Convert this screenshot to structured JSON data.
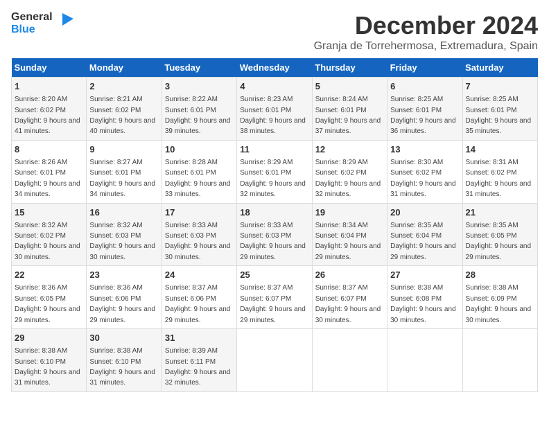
{
  "logo": {
    "general": "General",
    "blue": "Blue"
  },
  "title": "December 2024",
  "subtitle": "Granja de Torrehermosa, Extremadura, Spain",
  "days": [
    "Sunday",
    "Monday",
    "Tuesday",
    "Wednesday",
    "Thursday",
    "Friday",
    "Saturday"
  ],
  "weeks": [
    [
      {
        "day": "1",
        "sunrise": "Sunrise: 8:20 AM",
        "sunset": "Sunset: 6:02 PM",
        "daylight": "Daylight: 9 hours and 41 minutes."
      },
      {
        "day": "2",
        "sunrise": "Sunrise: 8:21 AM",
        "sunset": "Sunset: 6:02 PM",
        "daylight": "Daylight: 9 hours and 40 minutes."
      },
      {
        "day": "3",
        "sunrise": "Sunrise: 8:22 AM",
        "sunset": "Sunset: 6:01 PM",
        "daylight": "Daylight: 9 hours and 39 minutes."
      },
      {
        "day": "4",
        "sunrise": "Sunrise: 8:23 AM",
        "sunset": "Sunset: 6:01 PM",
        "daylight": "Daylight: 9 hours and 38 minutes."
      },
      {
        "day": "5",
        "sunrise": "Sunrise: 8:24 AM",
        "sunset": "Sunset: 6:01 PM",
        "daylight": "Daylight: 9 hours and 37 minutes."
      },
      {
        "day": "6",
        "sunrise": "Sunrise: 8:25 AM",
        "sunset": "Sunset: 6:01 PM",
        "daylight": "Daylight: 9 hours and 36 minutes."
      },
      {
        "day": "7",
        "sunrise": "Sunrise: 8:25 AM",
        "sunset": "Sunset: 6:01 PM",
        "daylight": "Daylight: 9 hours and 35 minutes."
      }
    ],
    [
      {
        "day": "8",
        "sunrise": "Sunrise: 8:26 AM",
        "sunset": "Sunset: 6:01 PM",
        "daylight": "Daylight: 9 hours and 34 minutes."
      },
      {
        "day": "9",
        "sunrise": "Sunrise: 8:27 AM",
        "sunset": "Sunset: 6:01 PM",
        "daylight": "Daylight: 9 hours and 34 minutes."
      },
      {
        "day": "10",
        "sunrise": "Sunrise: 8:28 AM",
        "sunset": "Sunset: 6:01 PM",
        "daylight": "Daylight: 9 hours and 33 minutes."
      },
      {
        "day": "11",
        "sunrise": "Sunrise: 8:29 AM",
        "sunset": "Sunset: 6:01 PM",
        "daylight": "Daylight: 9 hours and 32 minutes."
      },
      {
        "day": "12",
        "sunrise": "Sunrise: 8:29 AM",
        "sunset": "Sunset: 6:02 PM",
        "daylight": "Daylight: 9 hours and 32 minutes."
      },
      {
        "day": "13",
        "sunrise": "Sunrise: 8:30 AM",
        "sunset": "Sunset: 6:02 PM",
        "daylight": "Daylight: 9 hours and 31 minutes."
      },
      {
        "day": "14",
        "sunrise": "Sunrise: 8:31 AM",
        "sunset": "Sunset: 6:02 PM",
        "daylight": "Daylight: 9 hours and 31 minutes."
      }
    ],
    [
      {
        "day": "15",
        "sunrise": "Sunrise: 8:32 AM",
        "sunset": "Sunset: 6:02 PM",
        "daylight": "Daylight: 9 hours and 30 minutes."
      },
      {
        "day": "16",
        "sunrise": "Sunrise: 8:32 AM",
        "sunset": "Sunset: 6:03 PM",
        "daylight": "Daylight: 9 hours and 30 minutes."
      },
      {
        "day": "17",
        "sunrise": "Sunrise: 8:33 AM",
        "sunset": "Sunset: 6:03 PM",
        "daylight": "Daylight: 9 hours and 30 minutes."
      },
      {
        "day": "18",
        "sunrise": "Sunrise: 8:33 AM",
        "sunset": "Sunset: 6:03 PM",
        "daylight": "Daylight: 9 hours and 29 minutes."
      },
      {
        "day": "19",
        "sunrise": "Sunrise: 8:34 AM",
        "sunset": "Sunset: 6:04 PM",
        "daylight": "Daylight: 9 hours and 29 minutes."
      },
      {
        "day": "20",
        "sunrise": "Sunrise: 8:35 AM",
        "sunset": "Sunset: 6:04 PM",
        "daylight": "Daylight: 9 hours and 29 minutes."
      },
      {
        "day": "21",
        "sunrise": "Sunrise: 8:35 AM",
        "sunset": "Sunset: 6:05 PM",
        "daylight": "Daylight: 9 hours and 29 minutes."
      }
    ],
    [
      {
        "day": "22",
        "sunrise": "Sunrise: 8:36 AM",
        "sunset": "Sunset: 6:05 PM",
        "daylight": "Daylight: 9 hours and 29 minutes."
      },
      {
        "day": "23",
        "sunrise": "Sunrise: 8:36 AM",
        "sunset": "Sunset: 6:06 PM",
        "daylight": "Daylight: 9 hours and 29 minutes."
      },
      {
        "day": "24",
        "sunrise": "Sunrise: 8:37 AM",
        "sunset": "Sunset: 6:06 PM",
        "daylight": "Daylight: 9 hours and 29 minutes."
      },
      {
        "day": "25",
        "sunrise": "Sunrise: 8:37 AM",
        "sunset": "Sunset: 6:07 PM",
        "daylight": "Daylight: 9 hours and 29 minutes."
      },
      {
        "day": "26",
        "sunrise": "Sunrise: 8:37 AM",
        "sunset": "Sunset: 6:07 PM",
        "daylight": "Daylight: 9 hours and 30 minutes."
      },
      {
        "day": "27",
        "sunrise": "Sunrise: 8:38 AM",
        "sunset": "Sunset: 6:08 PM",
        "daylight": "Daylight: 9 hours and 30 minutes."
      },
      {
        "day": "28",
        "sunrise": "Sunrise: 8:38 AM",
        "sunset": "Sunset: 6:09 PM",
        "daylight": "Daylight: 9 hours and 30 minutes."
      }
    ],
    [
      {
        "day": "29",
        "sunrise": "Sunrise: 8:38 AM",
        "sunset": "Sunset: 6:10 PM",
        "daylight": "Daylight: 9 hours and 31 minutes."
      },
      {
        "day": "30",
        "sunrise": "Sunrise: 8:38 AM",
        "sunset": "Sunset: 6:10 PM",
        "daylight": "Daylight: 9 hours and 31 minutes."
      },
      {
        "day": "31",
        "sunrise": "Sunrise: 8:39 AM",
        "sunset": "Sunset: 6:11 PM",
        "daylight": "Daylight: 9 hours and 32 minutes."
      },
      null,
      null,
      null,
      null
    ]
  ]
}
